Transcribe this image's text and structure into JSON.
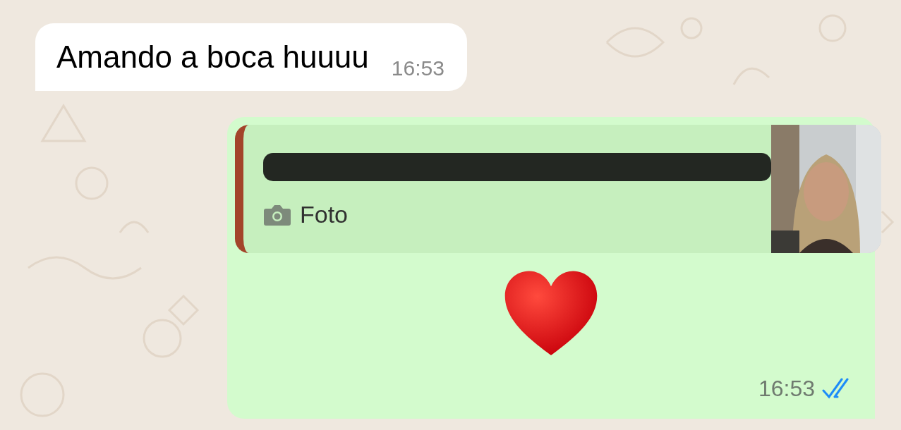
{
  "messages": [
    {
      "kind": "incoming",
      "text": "Amando a boca huuuu",
      "time": "16:53"
    },
    {
      "kind": "outgoing",
      "reply": {
        "redacted": true,
        "media_label": "Foto"
      },
      "sticker": {
        "kind": "heart"
      },
      "time": "16:53",
      "read": true
    }
  ]
}
